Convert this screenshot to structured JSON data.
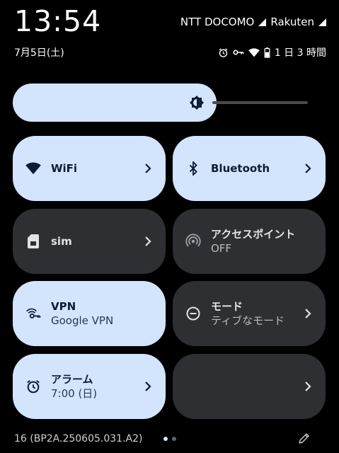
{
  "status_bar": {
    "time": "13:54",
    "carrier1": "NTT DOCOMO",
    "carrier2": "Rakuten",
    "date": "7月5日(土)",
    "battery_text": "1 日 3 時間",
    "icons": [
      "alarm-icon",
      "vpn-key-icon",
      "wifi-icon",
      "battery-icon"
    ]
  },
  "brightness": {
    "level": 0.66,
    "icon": "brightness-icon"
  },
  "tiles": [
    {
      "label": "WiFi",
      "state": "on",
      "icon": "wifi-icon",
      "chevron": true
    },
    {
      "label": "Bluetooth",
      "state": "on",
      "icon": "bluetooth-icon",
      "chevron": true
    },
    {
      "label": "sim",
      "state": "off",
      "icon": "sim-card-icon",
      "chevron": true
    },
    {
      "label": "アクセスポイント",
      "sub": "OFF",
      "state": "off",
      "icon": "hotspot-icon",
      "chevron": false
    },
    {
      "label": "VPN",
      "sub": "Google VPN",
      "state": "on",
      "icon": "vpn-key-icon",
      "chevron": false
    },
    {
      "label": "モード",
      "sub": "ティブなモード",
      "state": "off",
      "icon": "do-not-disturb-icon",
      "chevron": true
    },
    {
      "label": "アラーム",
      "sub": "7:00 (日)",
      "state": "on",
      "icon": "alarm-icon",
      "chevron": true
    },
    {
      "label": "",
      "state": "off",
      "icon": "",
      "chevron": true
    }
  ],
  "footer": {
    "build": "16 (BP2A.250605.031.A2)",
    "pages": 2,
    "current_page": 1,
    "edit_icon": "edit-icon"
  },
  "colors": {
    "tile_on": "#d3e4fd",
    "tile_off": "#2e2f33",
    "on_text": "#0b1d33",
    "off_text": "#e3e3e3"
  }
}
